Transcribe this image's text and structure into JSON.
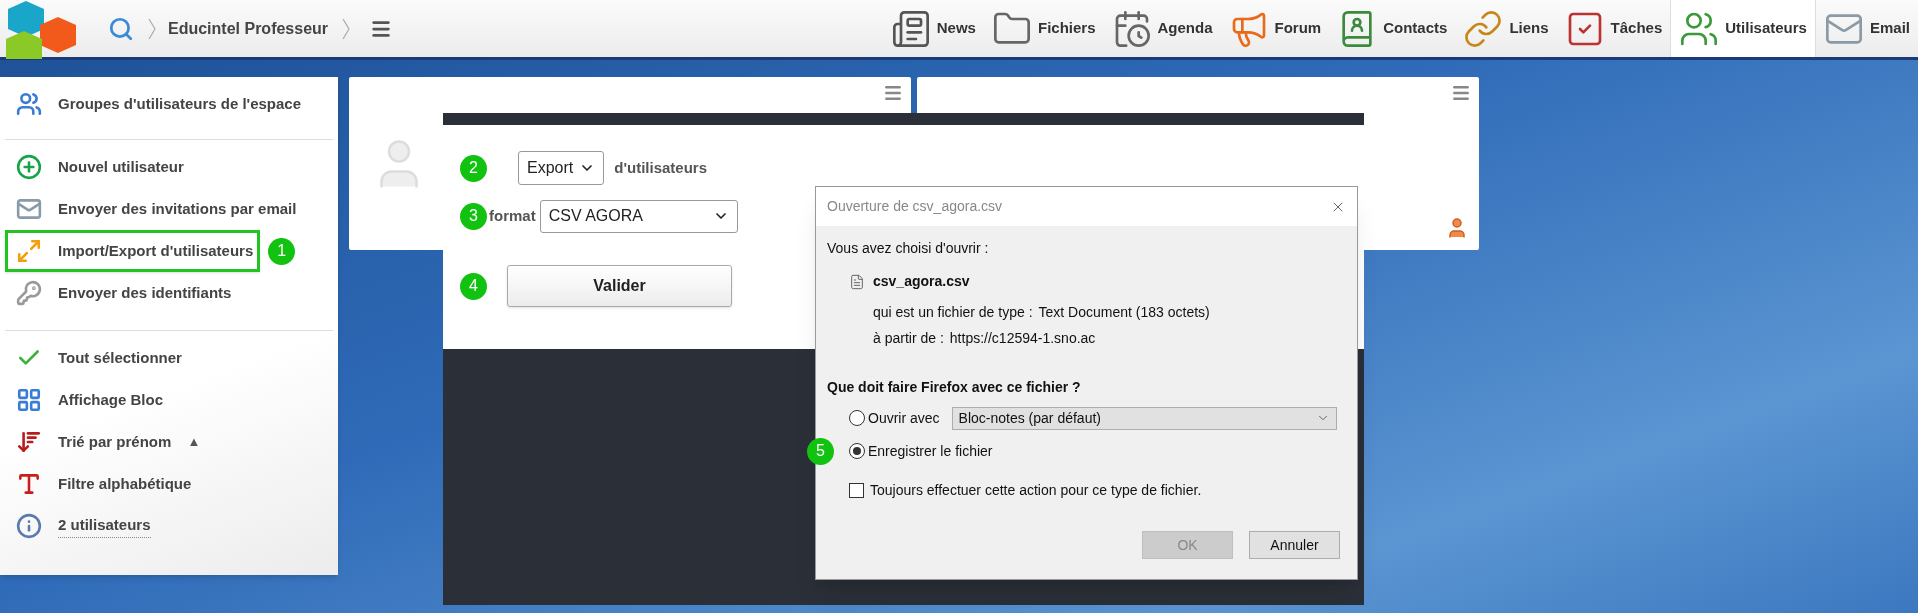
{
  "header": {
    "breadcrumb": "Educintel Professeur",
    "nav": [
      {
        "label": "News",
        "selected": false
      },
      {
        "label": "Fichiers",
        "selected": false
      },
      {
        "label": "Agenda",
        "selected": false
      },
      {
        "label": "Forum",
        "selected": false
      },
      {
        "label": "Contacts",
        "selected": false
      },
      {
        "label": "Liens",
        "selected": false
      },
      {
        "label": "Tâches",
        "selected": false
      },
      {
        "label": "Utilisateurs",
        "selected": true
      },
      {
        "label": "Email",
        "selected": false
      }
    ]
  },
  "sidebar": {
    "groups": [
      [
        {
          "label": "Groupes d'utilisateurs de l'espace",
          "highlighted": false
        }
      ],
      [
        {
          "label": "Nouvel utilisateur",
          "highlighted": false
        },
        {
          "label": "Envoyer des invitations par email",
          "highlighted": false
        },
        {
          "label": "Import/Export d'utilisateurs",
          "highlighted": true,
          "step": "1"
        },
        {
          "label": "Envoyer des identifiants",
          "highlighted": false
        }
      ],
      [
        {
          "label": "Tout sélectionner",
          "highlighted": false
        },
        {
          "label": "Affichage Bloc",
          "highlighted": false
        },
        {
          "label": "Trié par prénom",
          "highlighted": false,
          "suffix": "▲"
        },
        {
          "label": "Filtre alphabétique",
          "highlighted": false
        },
        {
          "label": "2 utilisateurs",
          "highlighted": false
        }
      ]
    ]
  },
  "import_export_form": {
    "mode_step": "2",
    "mode": "Export",
    "mode_label": "d'utilisateurs",
    "format_step": "3",
    "format_label": "format",
    "format": "CSV AGORA",
    "submit_step": "4",
    "submit": "Valider"
  },
  "download_dialog": {
    "title": "Ouverture de csv_agora.csv",
    "intro": "Vous avez choisi d'ouvrir :",
    "file_name": "csv_agora.csv",
    "details": [
      {
        "label": "qui est un fichier de type :",
        "value": "Text Document (183 octets)"
      },
      {
        "label": "à partir de :",
        "value": "https://c12594-1.sno.ac"
      }
    ],
    "question": "Que doit faire Firefox avec ce fichier ?",
    "options": [
      {
        "label": "Ouvrir avec",
        "selected": false,
        "app": "Bloc-notes (par défaut)"
      },
      {
        "label": "Enregistrer le fichier",
        "selected": true,
        "step": "5"
      }
    ],
    "always": {
      "label": "Toujours effectuer cette action pour ce type de fichier.",
      "checked": false
    },
    "buttons": [
      {
        "label": "OK",
        "disabled": true
      },
      {
        "label": "Annuler",
        "disabled": false
      }
    ]
  }
}
